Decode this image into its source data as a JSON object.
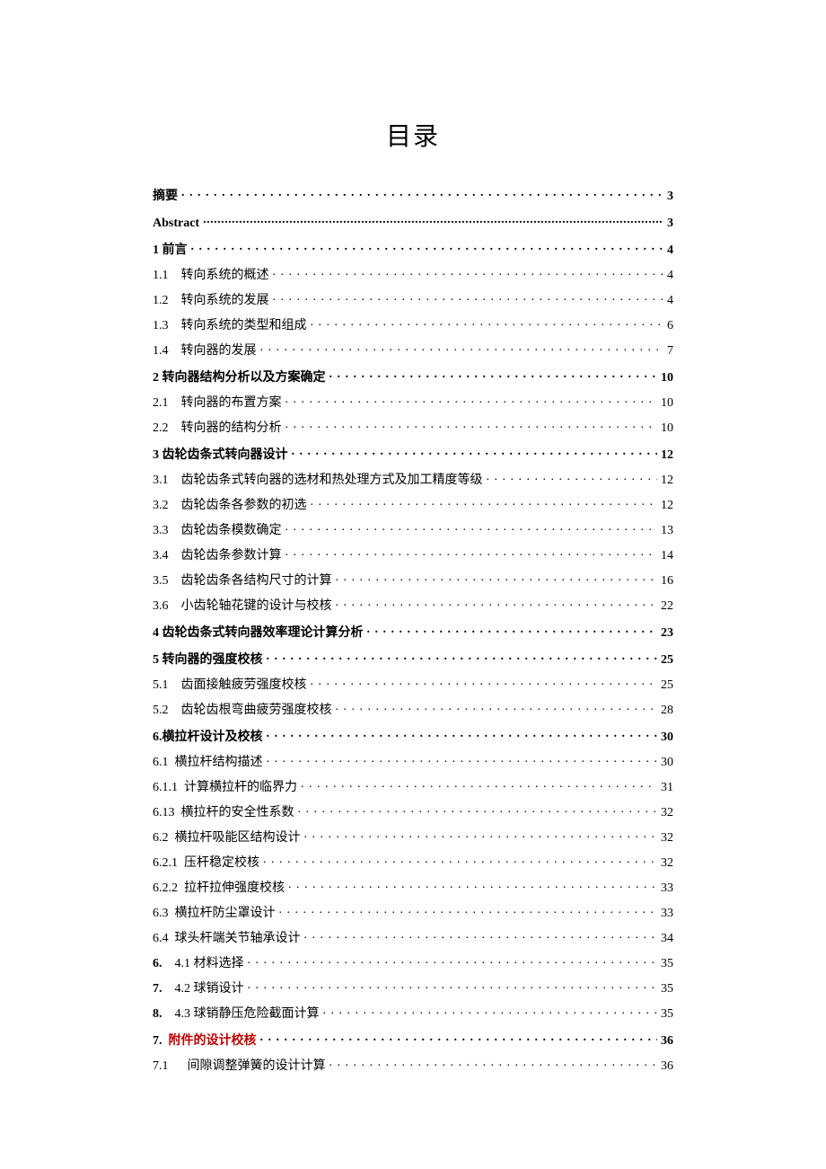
{
  "title": "目录",
  "entries": [
    {
      "num": "",
      "gap": "",
      "label": "摘要",
      "page": "3",
      "bold": true,
      "level": 0,
      "redLabel": false
    },
    {
      "num": "",
      "gap": "",
      "label": "Abstract",
      "page": "3",
      "bold": true,
      "level": 0,
      "tight": true,
      "redLabel": false
    },
    {
      "num": "",
      "gap": "",
      "label": "1 前言",
      "page": "4",
      "bold": true,
      "level": 0,
      "redLabel": false
    },
    {
      "num": "1.1",
      "gap": "  ",
      "label": "转向系统的概述",
      "page": "4",
      "bold": false,
      "level": 1,
      "redLabel": false
    },
    {
      "num": "1.2",
      "gap": "  ",
      "label": "转向系统的发展",
      "page": "4",
      "bold": false,
      "level": 1,
      "redLabel": false
    },
    {
      "num": "1.3",
      "gap": "  ",
      "label": "转向系统的类型和组成",
      "page": "6",
      "bold": false,
      "level": 1,
      "redLabel": false
    },
    {
      "num": "1.4",
      "gap": "  ",
      "label": "转向器的发展",
      "page": "7",
      "bold": false,
      "level": 1,
      "redLabel": false
    },
    {
      "num": "",
      "gap": "",
      "label": "2 转向器结构分析以及方案确定",
      "page": "10",
      "bold": true,
      "level": 0,
      "redLabel": false
    },
    {
      "num": "2.1",
      "gap": "  ",
      "label": "转向器的布置方案",
      "page": "10",
      "bold": false,
      "level": 1,
      "redLabel": false
    },
    {
      "num": "2.2",
      "gap": "  ",
      "label": "转向器的结构分析",
      "page": "10",
      "bold": false,
      "level": 1,
      "redLabel": false
    },
    {
      "num": "",
      "gap": "",
      "label": "3 齿轮齿条式转向器设计",
      "page": "12",
      "bold": true,
      "level": 0,
      "redLabel": false
    },
    {
      "num": "3.1",
      "gap": "  ",
      "label": "齿轮齿条式转向器的选材和热处理方式及加工精度等级",
      "page": "12",
      "bold": false,
      "level": 1,
      "redLabel": false
    },
    {
      "num": "3.2",
      "gap": "  ",
      "label": "齿轮齿条各参数的初选",
      "page": "12",
      "bold": false,
      "level": 1,
      "redLabel": false
    },
    {
      "num": "3.3",
      "gap": "  ",
      "label": "齿轮齿条模数确定",
      "page": "13",
      "bold": false,
      "level": 1,
      "redLabel": false
    },
    {
      "num": "3.4",
      "gap": "  ",
      "label": "齿轮齿条参数计算",
      "page": "14",
      "bold": false,
      "level": 1,
      "redLabel": false
    },
    {
      "num": "3.5",
      "gap": "  ",
      "label": "齿轮齿条各结构尺寸的计算",
      "page": "16",
      "bold": false,
      "level": 1,
      "redLabel": false
    },
    {
      "num": "3.6",
      "gap": "  ",
      "label": "小齿轮轴花键的设计与校核",
      "page": "22",
      "bold": false,
      "level": 1,
      "redLabel": false
    },
    {
      "num": "",
      "gap": "",
      "label": "4 齿轮齿条式转向器效率理论计算分析",
      "page": "23",
      "bold": true,
      "level": 0,
      "redLabel": false
    },
    {
      "num": "",
      "gap": "",
      "label": "5 转向器的强度校核",
      "page": "25",
      "bold": true,
      "level": 0,
      "redLabel": false
    },
    {
      "num": "5.1",
      "gap": "  ",
      "label": "齿面接触疲劳强度校核",
      "page": "25",
      "bold": false,
      "level": 1,
      "redLabel": false
    },
    {
      "num": "5.2",
      "gap": "  ",
      "label": "齿轮齿根弯曲疲劳强度校核",
      "page": "28",
      "bold": false,
      "level": 1,
      "redLabel": false
    },
    {
      "num": "",
      "gap": "",
      "label": "6.横拉杆设计及校核",
      "page": "30",
      "bold": true,
      "level": 0,
      "redLabel": false
    },
    {
      "num": "6.1",
      "gap": " ",
      "label": "横拉杆结构描述",
      "page": "30",
      "bold": false,
      "level": 0,
      "redLabel": false
    },
    {
      "num": "6.1.1",
      "gap": " ",
      "label": "计算横拉杆的临界力",
      "page": "31",
      "bold": false,
      "level": 0,
      "redLabel": false
    },
    {
      "num": "6.13",
      "gap": " ",
      "label": "横拉杆的安全性系数",
      "page": "32",
      "bold": false,
      "level": 0,
      "redLabel": false
    },
    {
      "num": "6.2",
      "gap": " ",
      "label": "横拉杆吸能区结构设计",
      "page": "32",
      "bold": false,
      "level": 0,
      "redLabel": false
    },
    {
      "num": "6.2.1",
      "gap": " ",
      "label": "压杆稳定校核",
      "page": "32",
      "bold": false,
      "level": 0,
      "redLabel": false
    },
    {
      "num": "6.2.2",
      "gap": " ",
      "label": "拉杆拉伸强度校核",
      "page": "33",
      "bold": false,
      "level": 0,
      "redLabel": false
    },
    {
      "num": "6.3",
      "gap": " ",
      "label": "横拉杆防尘罩设计",
      "page": "33",
      "bold": false,
      "level": 0,
      "redLabel": false
    },
    {
      "num": "6.4",
      "gap": " ",
      "label": "球头杆端关节轴承设计",
      "page": "34",
      "bold": false,
      "level": 0,
      "redLabel": false
    },
    {
      "num": "6.",
      "gap": "  ",
      "label": "4.1 材料选择",
      "page": "35",
      "bold": false,
      "level": 0,
      "numBold": true,
      "redLabel": false
    },
    {
      "num": "7.",
      "gap": "  ",
      "label": "4.2 球销设计",
      "page": "35",
      "bold": false,
      "level": 0,
      "numBold": true,
      "redLabel": false
    },
    {
      "num": "8.",
      "gap": "  ",
      "label": "4.3 球销静压危险截面计算",
      "page": "35",
      "bold": false,
      "level": 0,
      "numBold": true,
      "redLabel": false
    },
    {
      "num": "7.",
      "gap": " ",
      "label": "附件的设计校核",
      "page": "36",
      "bold": true,
      "level": 0,
      "redLabel": true
    },
    {
      "num": "7.1",
      "gap": "   ",
      "label": "间隙调整弹簧的设计计算",
      "page": "36",
      "bold": false,
      "level": 0,
      "redLabel": false
    }
  ]
}
